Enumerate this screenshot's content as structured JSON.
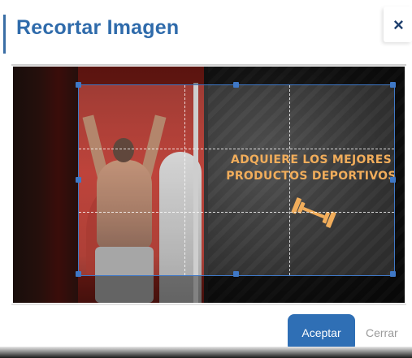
{
  "dialog": {
    "title": "Recortar Imagen",
    "close_icon": "close-icon",
    "close_glyph": "×"
  },
  "image": {
    "promo_line1": "ADQUIERE LOS MEJORES",
    "promo_line2": "PRODUCTOS DEPORTIVOS",
    "promo_icon": "dumbbell-icon",
    "promo_color": "#f0a245"
  },
  "crop": {
    "grid_color": "#ffffff",
    "frame_color": "#3f78c6"
  },
  "footer": {
    "accept_label": "Aceptar",
    "close_label": "Cerrar",
    "accept_color": "#2f6fb5"
  }
}
